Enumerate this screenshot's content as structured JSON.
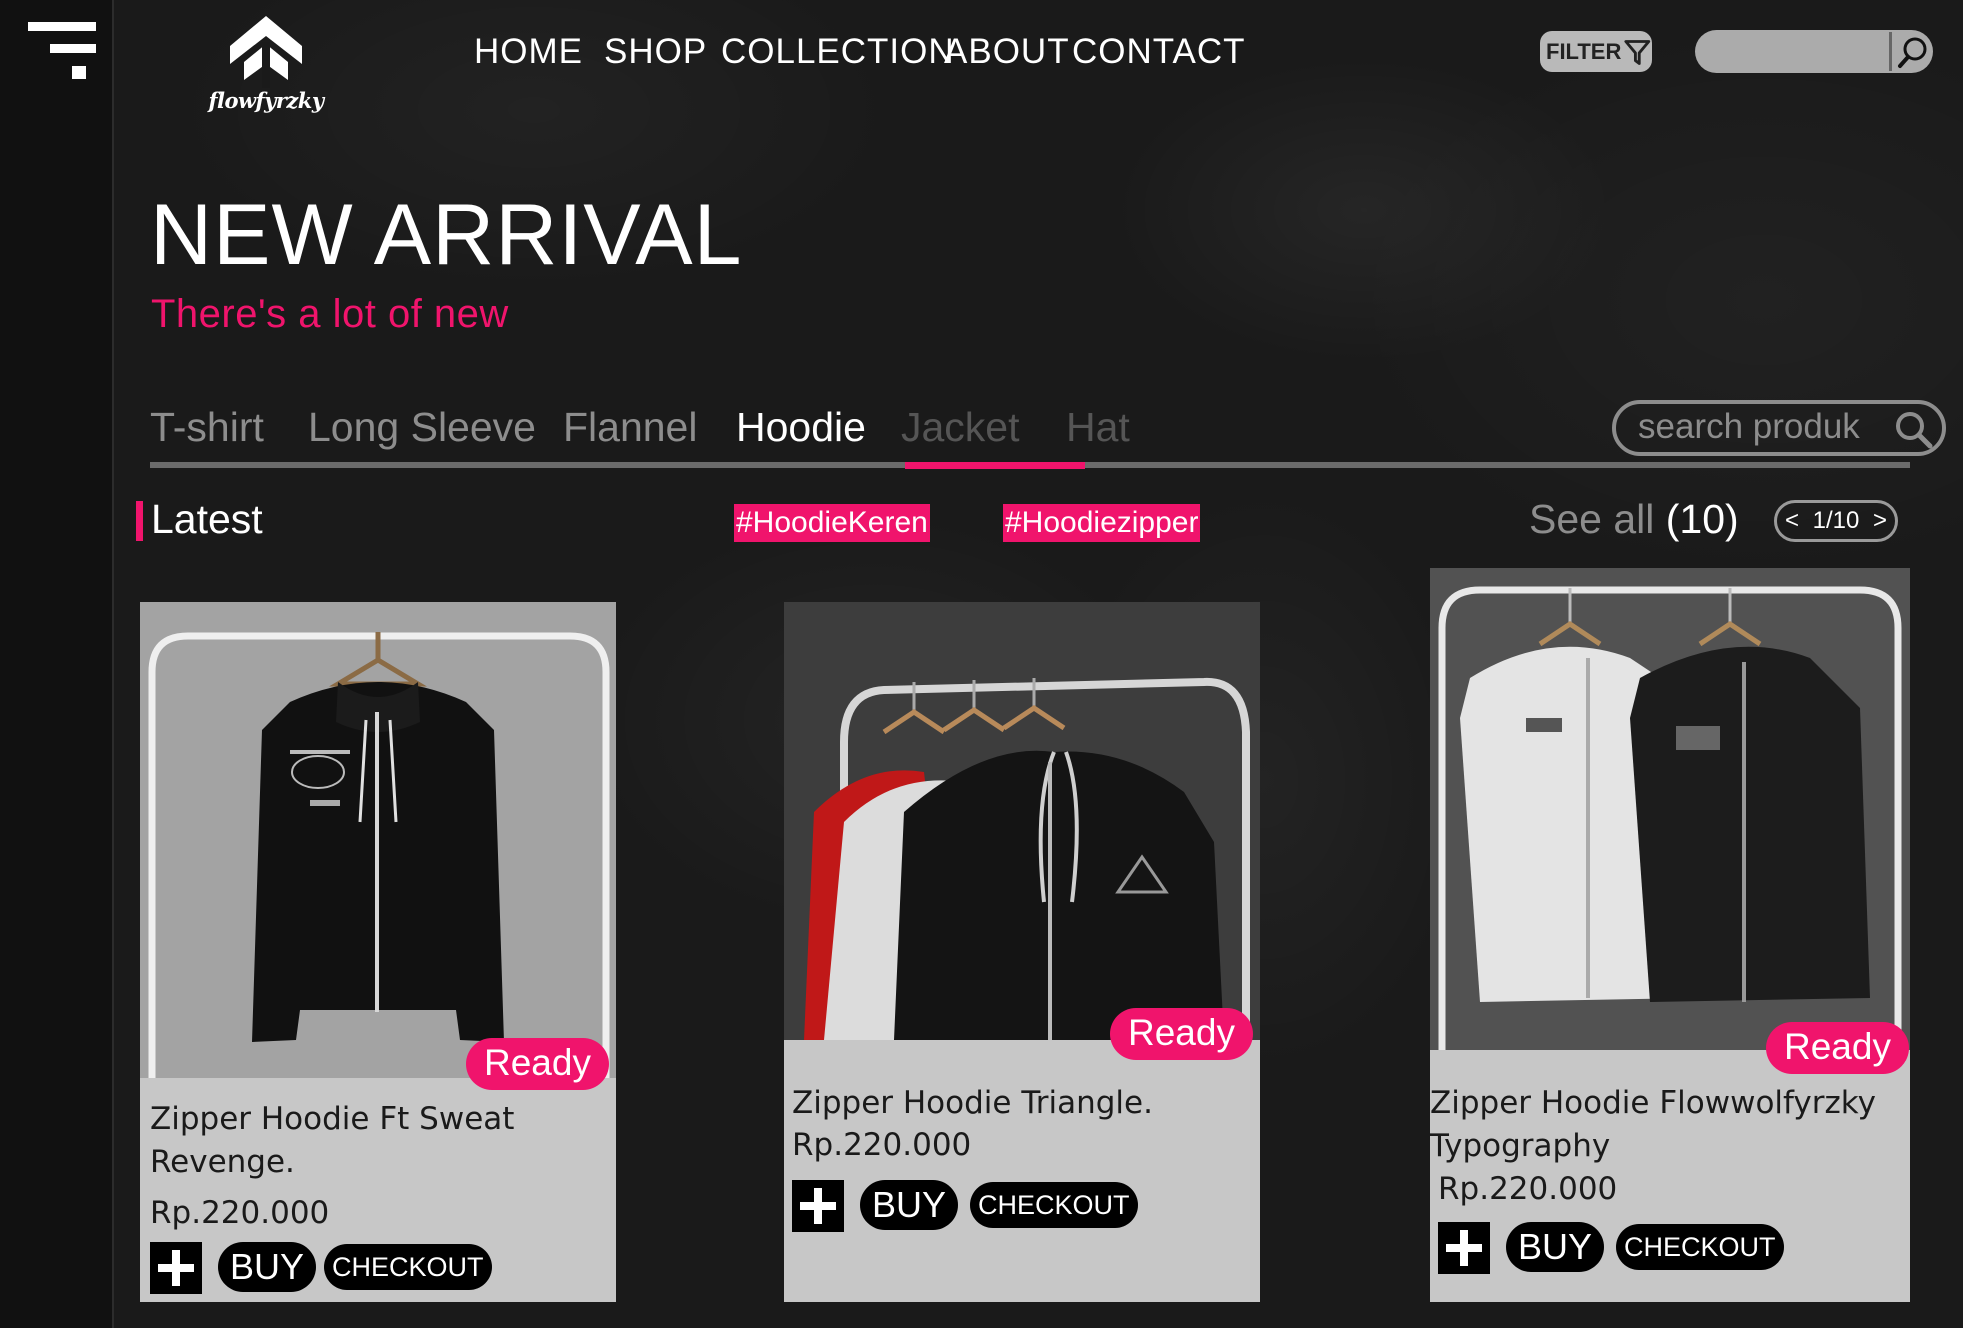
{
  "brand": {
    "name": "flowfyrzky"
  },
  "nav": {
    "items": [
      "HOME",
      "SHOP",
      "COLLECTION",
      "ABOUT",
      "CONTACT"
    ]
  },
  "toolbar": {
    "filter_label": "FILTER",
    "search_placeholder": ""
  },
  "hero": {
    "title": "NEW ARRIVAL",
    "subtitle": "There's a lot of new"
  },
  "categories": {
    "tabs": [
      "T-shirt",
      "Long Sleeve",
      "Flannel",
      "Hoodie",
      "Jacket",
      "Hat"
    ],
    "active": "Hoodie",
    "search_placeholder": "search produk"
  },
  "section": {
    "title": "Latest",
    "tags": [
      "#HoodieKeren",
      "#Hoodiezipper"
    ],
    "see_all_label": "See all",
    "see_all_count": "(10)",
    "pager": {
      "prev": "<",
      "page": "1/10",
      "next": ">"
    }
  },
  "products": [
    {
      "name": "Zipper Hoodie Ft Sweat Revenge.",
      "price": "Rp.220.000",
      "status": "Ready",
      "buy_label": "BUY",
      "checkout_label": "CHECKOUT"
    },
    {
      "name": "Zipper Hoodie Triangle.",
      "price": "Rp.220.000",
      "status": "Ready",
      "buy_label": "BUY",
      "checkout_label": "CHECKOUT"
    },
    {
      "name": "Zipper Hoodie Flowwolfyrzky Typography",
      "price": "Rp.220.000",
      "status": "Ready",
      "buy_label": "BUY",
      "checkout_label": "CHECKOUT"
    }
  ],
  "colors": {
    "accent": "#f0146c",
    "background": "#1a1a1a",
    "card": "#c7c7c7"
  },
  "icons": [
    "menu-icon",
    "logo-icon",
    "filter-icon",
    "search-icon",
    "plus-icon"
  ]
}
